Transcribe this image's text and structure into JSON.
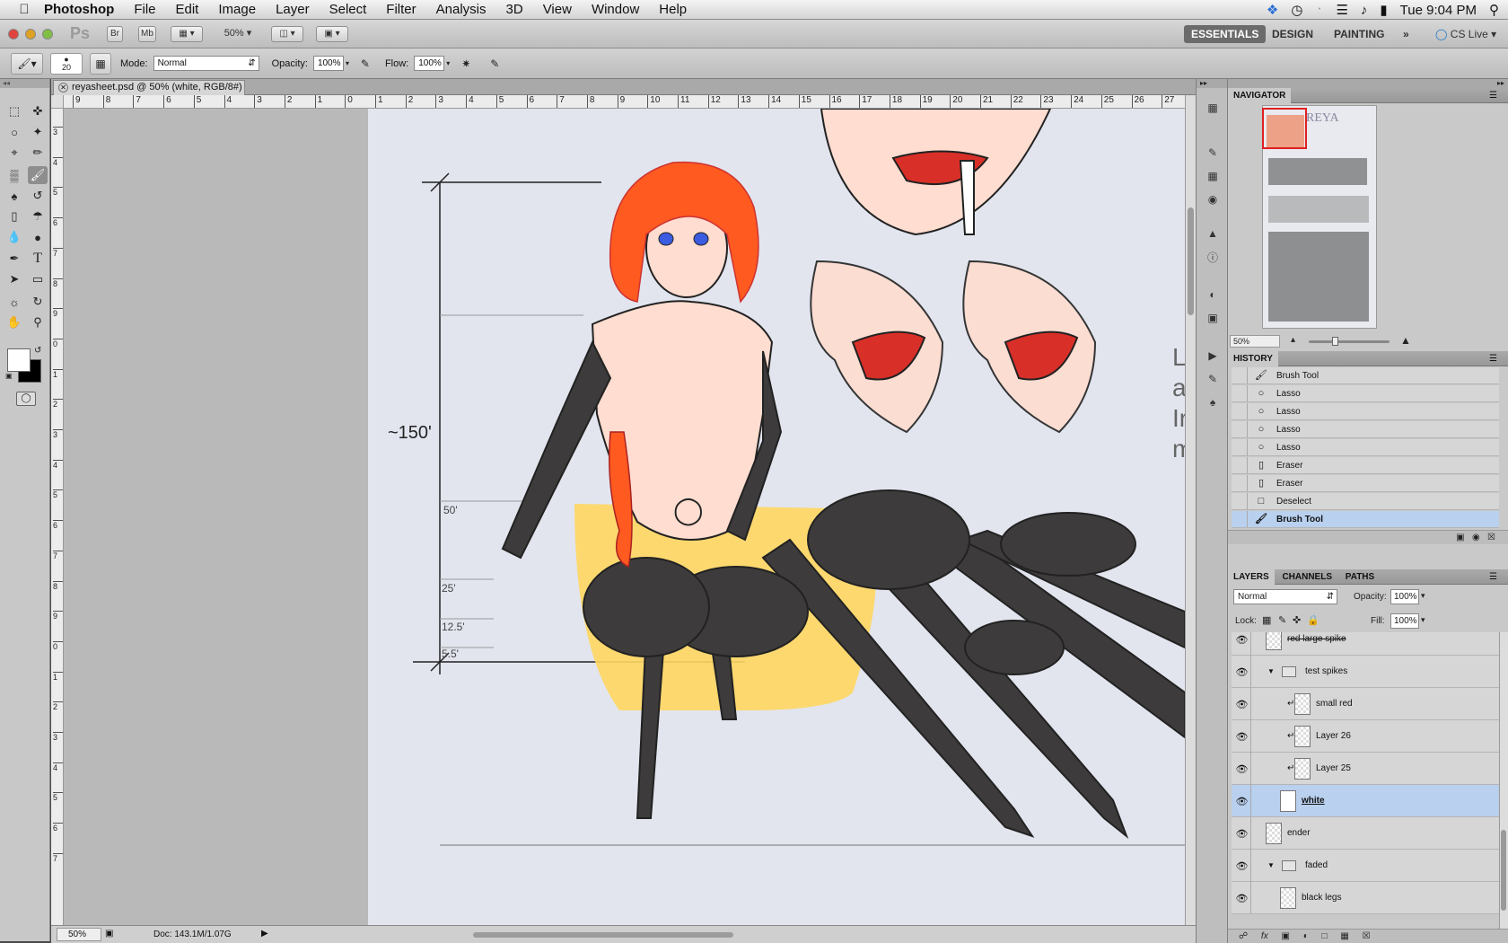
{
  "menubar": {
    "app": "Photoshop",
    "items": [
      "File",
      "Edit",
      "Image",
      "Layer",
      "Select",
      "Filter",
      "Analysis",
      "3D",
      "View",
      "Window",
      "Help"
    ],
    "clock": "Tue 9:04 PM"
  },
  "appbar": {
    "ps_logo": "Ps",
    "bridge": "Br",
    "minibridge": "Mb",
    "zoom": "50%",
    "workspaces": [
      "ESSENTIALS",
      "DESIGN",
      "PAINTING"
    ],
    "active_workspace": "ESSENTIALS",
    "more": "»",
    "cs_live": "CS Live"
  },
  "options": {
    "brush_size": "20",
    "mode_label": "Mode:",
    "mode_value": "Normal",
    "opacity_label": "Opacity:",
    "opacity_value": "100%",
    "flow_label": "Flow:",
    "flow_value": "100%"
  },
  "document": {
    "tab_title": "reyasheet.psd @ 50% (white, RGB/8#) *",
    "ruler_h": [
      "9",
      "8",
      "7",
      "6",
      "5",
      "4",
      "3",
      "2",
      "1",
      "0",
      "1",
      "2",
      "3",
      "4",
      "5",
      "6",
      "7",
      "8",
      "9",
      "10",
      "11",
      "12",
      "13",
      "14",
      "15",
      "16",
      "17",
      "18",
      "19",
      "20",
      "21",
      "22",
      "23",
      "24",
      "25",
      "26",
      "27"
    ],
    "ruler_v": [
      "3",
      "4",
      "5",
      "6",
      "7",
      "8",
      "9",
      "0",
      "1",
      "2",
      "3",
      "4",
      "5",
      "6",
      "7",
      "8",
      "9",
      "0",
      "1",
      "2",
      "3",
      "4",
      "5",
      "6",
      "7"
    ],
    "artwork": {
      "height_main": "~150'",
      "height_marks": [
        "50'",
        "25'",
        "12.5'",
        "5.5'"
      ],
      "side_text": [
        "L",
        "a",
        "Ir",
        "m"
      ]
    },
    "status_zoom": "50%",
    "status_doc": "Doc: 143.1M/1.07G"
  },
  "navigator": {
    "title": "NAVIGATOR",
    "zoom": "50%",
    "thumb_text": "REYA"
  },
  "history": {
    "title": "HISTORY",
    "items": [
      {
        "label": "Brush Tool",
        "icon": "brush"
      },
      {
        "label": "Lasso",
        "icon": "lasso"
      },
      {
        "label": "Lasso",
        "icon": "lasso"
      },
      {
        "label": "Lasso",
        "icon": "lasso"
      },
      {
        "label": "Lasso",
        "icon": "lasso"
      },
      {
        "label": "Eraser",
        "icon": "eraser"
      },
      {
        "label": "Eraser",
        "icon": "eraser"
      },
      {
        "label": "Deselect",
        "icon": "deselect"
      },
      {
        "label": "Brush Tool",
        "icon": "brush",
        "selected": true
      }
    ]
  },
  "layers": {
    "tabs": [
      "LAYERS",
      "CHANNELS",
      "PATHS"
    ],
    "blend_mode": "Normal",
    "opacity_label": "Opacity:",
    "opacity": "100%",
    "lock_label": "Lock:",
    "fill_label": "Fill:",
    "fill": "100%",
    "items": [
      {
        "name": "red large spike",
        "type": "layer",
        "indent": 0
      },
      {
        "name": "test spikes",
        "type": "group",
        "indent": 1
      },
      {
        "name": "small red",
        "type": "layer",
        "indent": 2,
        "clipped": true
      },
      {
        "name": "Layer 26",
        "type": "layer",
        "indent": 2,
        "clipped": true
      },
      {
        "name": "Layer 25",
        "type": "layer",
        "indent": 2,
        "clipped": true
      },
      {
        "name": "white",
        "type": "layer",
        "indent": 1,
        "selected": true
      },
      {
        "name": "ender",
        "type": "layer",
        "indent": 0
      },
      {
        "name": "faded",
        "type": "group",
        "indent": 1
      },
      {
        "name": "black legs",
        "type": "layer",
        "indent": 1
      }
    ]
  },
  "colors": {
    "hair": "#ff5a1f",
    "skin": "#ffddd0",
    "spider": "#3d3b3b",
    "glow": "#ffd660",
    "mouth": "#d83028",
    "selection": "#b9d0ee"
  }
}
